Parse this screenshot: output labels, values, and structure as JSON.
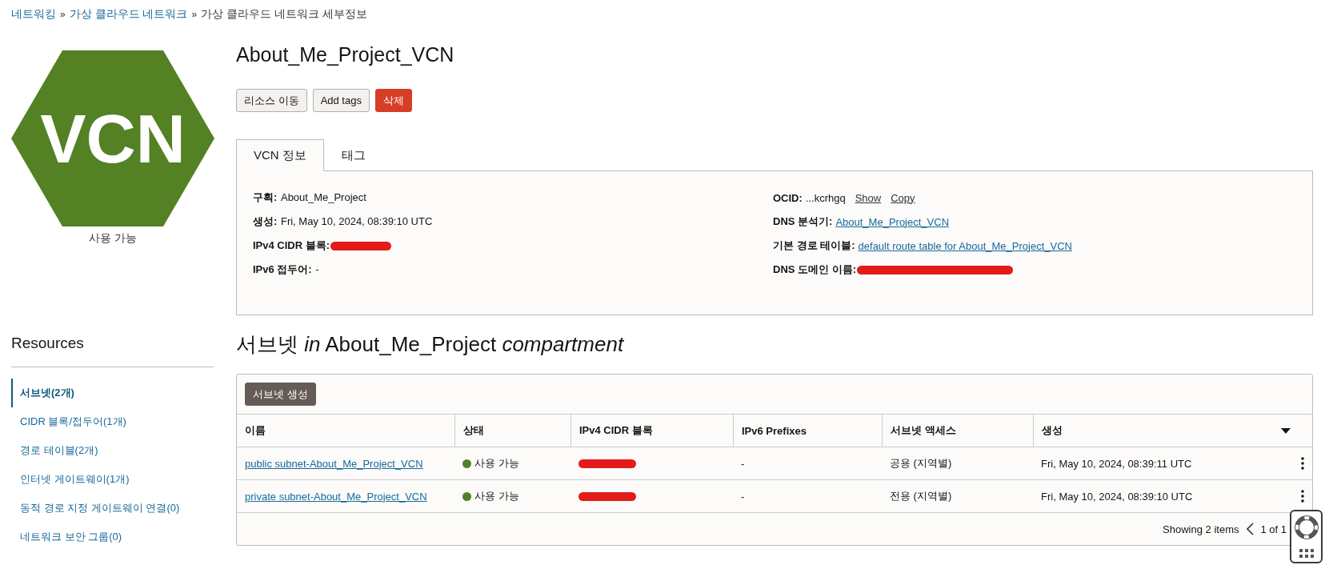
{
  "breadcrumb": [
    {
      "label": "네트워킹",
      "link": true,
      "separator": "»"
    },
    {
      "label": "가상 클라우드 네트워크",
      "link": true,
      "separator": "»"
    },
    {
      "label": "가상 클라우드 네트워크 세부정보",
      "link": false
    }
  ],
  "resource": {
    "logo_text": "VCN",
    "status": "사용 가능",
    "name": "About_Me_Project_VCN"
  },
  "actions": [
    {
      "label": "리소스 이동",
      "kind": "default"
    },
    {
      "label": "Add tags",
      "kind": "default"
    },
    {
      "label": "삭제",
      "kind": "danger"
    }
  ],
  "tabs": [
    {
      "label": "VCN 정보",
      "selected": true
    },
    {
      "label": "태그",
      "selected": false
    }
  ],
  "details": {
    "left": [
      {
        "kind": "text",
        "text": "**구획:** About_Me_Project"
      },
      {
        "kind": "text",
        "text": "**생성:** Fri, May 10, 2024, 08:39:10 UTC"
      },
      {
        "label": "IPv4 CIDR 블록:",
        "kind": "redacted"
      },
      {
        "kind": "text",
        "text": "**IPv6 접두어:** -"
      }
    ],
    "right": [
      {
        "label": "OCID:",
        "kind": "ocid",
        "value": "...kcrhgq",
        "actions": [
          "Show",
          "Copy"
        ]
      },
      {
        "label": "DNS 분석기:",
        "kind": "link",
        "value": "About_Me_Project_VCN"
      },
      {
        "label": "기본 경로 테이블:",
        "kind": "link",
        "value": "default route table for About_Me_Project_VCN"
      },
      {
        "label": "DNS 도메인 이름:",
        "kind": "redacted"
      }
    ]
  },
  "resources": {
    "title": "Resources",
    "items": [
      {
        "label": "서브넷(2개)",
        "selected": true
      },
      {
        "label": "CIDR 블록/접두어(1개)",
        "selected": false
      },
      {
        "label": "경로 테이블(2개)",
        "selected": false
      },
      {
        "label": "인터넷 게이트웨이(1개)",
        "selected": false
      },
      {
        "label": "동적 경로 지정 게이트웨이 연결(0)",
        "selected": false
      },
      {
        "label": "네트워크 보안 그룹(0)",
        "selected": false
      }
    ]
  },
  "subnets": {
    "heading": "서브넷 *in* About_Me_Project *compartment*",
    "create_button": "서브넷 생성",
    "columns": [
      {
        "label": "이름",
        "sorted": false
      },
      {
        "label": "상태",
        "sorted": false
      },
      {
        "label": "IPv4 CIDR 블록",
        "sorted": false
      },
      {
        "label": "IPv6 Prefixes",
        "sorted": false
      },
      {
        "label": "서브넷 액세스",
        "sorted": false
      },
      {
        "label": "생성",
        "sorted": true
      }
    ],
    "rows": [
      {
        "name": "public subnet-About_Me_Project_VCN",
        "status": {
          "label": "사용 가능",
          "color": "#538124"
        },
        "ipv4_redacted": true,
        "ipv6": "-",
        "access": "공용 (지역별)",
        "created": "Fri, May 10, 2024, 08:39:11 UTC"
      },
      {
        "name": "private subnet-About_Me_Project_VCN",
        "status": {
          "label": "사용 가능",
          "color": "#538124"
        },
        "ipv4_redacted": true,
        "ipv6": "-",
        "access": "전용 (지역별)",
        "created": "Fri, May 10, 2024, 08:39:10 UTC"
      }
    ],
    "footer": {
      "summary": "Showing 2 items",
      "page": "1 of 1"
    }
  }
}
